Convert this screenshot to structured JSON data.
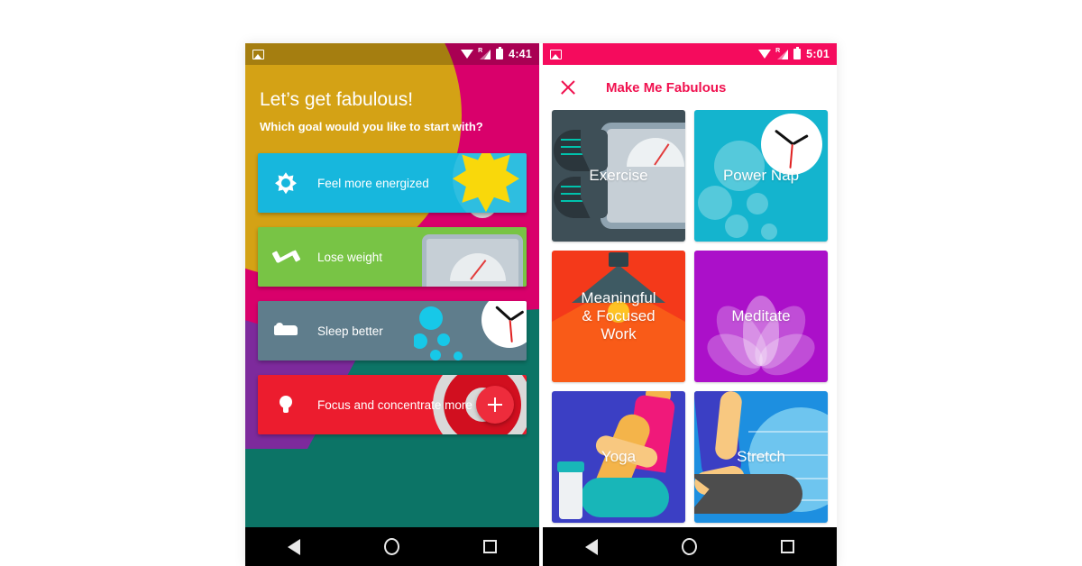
{
  "colors": {
    "brand_pink": "#f0114f",
    "status_pink": "#f50b5d",
    "left_bg_pink": "#d9006b",
    "left_bg_gold": "#d4a215",
    "left_bg_teal": "#0c7466",
    "left_bg_purple": "#7d2a9c",
    "card_energized": "#17b7dd",
    "card_weight": "#78c445",
    "card_sleep": "#5f7d8c",
    "card_focus": "#ec1c2e",
    "tile_exercise": "#3e4f57",
    "tile_nap": "#14b4ce",
    "tile_work": "#f4391a",
    "tile_meditate": "#ab10c9",
    "tile_yoga": "#3b3fc4",
    "tile_stretch": "#1d8fe0",
    "nav_bar": "#000000"
  },
  "left_phone": {
    "status_bar": {
      "photo_icon": "photo-icon",
      "wifi_icon": "wifi-icon",
      "signal_icon": "signal-icon",
      "roaming_indicator": "R",
      "battery_icon": "battery-icon",
      "time": "4:41"
    },
    "headline": "Let’s get fabulous!",
    "subhead": "Which goal would you like to start with?",
    "goals": [
      {
        "label": "Feel more energized",
        "icon": "sun-icon",
        "color": "#17b7dd",
        "art": "sun-graphic"
      },
      {
        "label": "Lose weight",
        "icon": "dumbbell-icon",
        "color": "#78c445",
        "art": "bathroom-scale-graphic"
      },
      {
        "label": "Sleep better",
        "icon": "bed-icon",
        "color": "#5f7d8c",
        "art": "clock-bubbles-graphic"
      },
      {
        "label": "Focus and concentrate more",
        "icon": "lightbulb-icon",
        "color": "#ec1c2e",
        "art": "target-graphic"
      }
    ],
    "fab": {
      "icon": "plus-icon"
    },
    "nav_bar": {
      "back": "back-icon",
      "home": "home-icon",
      "recents": "recents-icon"
    }
  },
  "right_phone": {
    "status_bar": {
      "photo_icon": "photo-icon",
      "wifi_icon": "wifi-icon",
      "signal_icon": "signal-icon",
      "roaming_indicator": "R",
      "battery_icon": "battery-icon",
      "time": "5:01"
    },
    "app_bar": {
      "close_icon": "close-icon",
      "title": "Make Me Fabulous"
    },
    "tiles": [
      {
        "label": "Exercise",
        "color": "#3e4f57",
        "art": "running-shoes-and-scale"
      },
      {
        "label": "Power Nap",
        "color": "#14b4ce",
        "art": "clock-and-bubbles"
      },
      {
        "label": "Meaningful\n& Focused\nWork",
        "line1": "Meaningful",
        "line2": "& Focused",
        "line3": "Work",
        "color": "#f4391a",
        "art": "desk-lamp"
      },
      {
        "label": "Meditate",
        "color": "#ab10c9",
        "art": "lotus-flower"
      },
      {
        "label": "Yoga",
        "color": "#3b3fc4",
        "art": "seated-figure-and-water-bottle"
      },
      {
        "label": "Stretch",
        "color": "#1d8fe0",
        "art": "figure-with-exercise-ball"
      }
    ],
    "nav_bar": {
      "back": "back-icon",
      "home": "home-icon",
      "recents": "recents-icon"
    }
  }
}
